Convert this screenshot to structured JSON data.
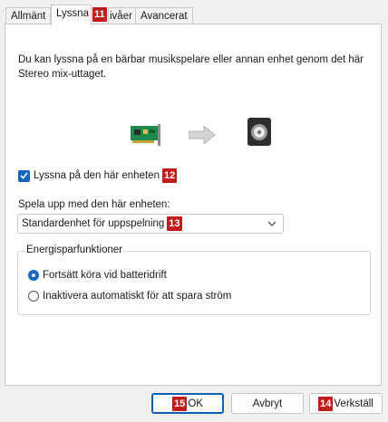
{
  "tabs": [
    {
      "label": "Allmänt",
      "active": false
    },
    {
      "label": "Lyssna",
      "active": true,
      "marker": "11"
    },
    {
      "label": "Nivåer",
      "active": false,
      "visible_label": "ivåer"
    },
    {
      "label": "Avancerat",
      "active": false
    }
  ],
  "description": "Du kan lyssna på en bärbar musikspelare eller annan enhet genom det här Stereo mix-uttaget.",
  "illustration": {
    "source_icon": "sound-card-icon",
    "arrow_icon": "arrow-right-icon",
    "target_icon": "speaker-icon"
  },
  "listen_checkbox": {
    "label": "Lyssna på den här enheten",
    "checked": true,
    "marker": "12"
  },
  "playback": {
    "label": "Spela upp med den här enheten:",
    "selected": "Standardenhet för uppspelning",
    "marker": "13"
  },
  "power": {
    "title": "Energisparfunktioner",
    "options": [
      {
        "label": "Fortsätt köra vid batteridrift",
        "selected": true
      },
      {
        "label": "Inaktivera automatiskt för att spara ström",
        "selected": false
      }
    ]
  },
  "buttons": {
    "ok": {
      "label": "OK",
      "marker": "15"
    },
    "cancel": {
      "label": "Avbryt"
    },
    "apply": {
      "label": "Verkställ",
      "marker": "14"
    }
  },
  "colors": {
    "accent": "#1565c0",
    "marker": "#c01c1c"
  }
}
